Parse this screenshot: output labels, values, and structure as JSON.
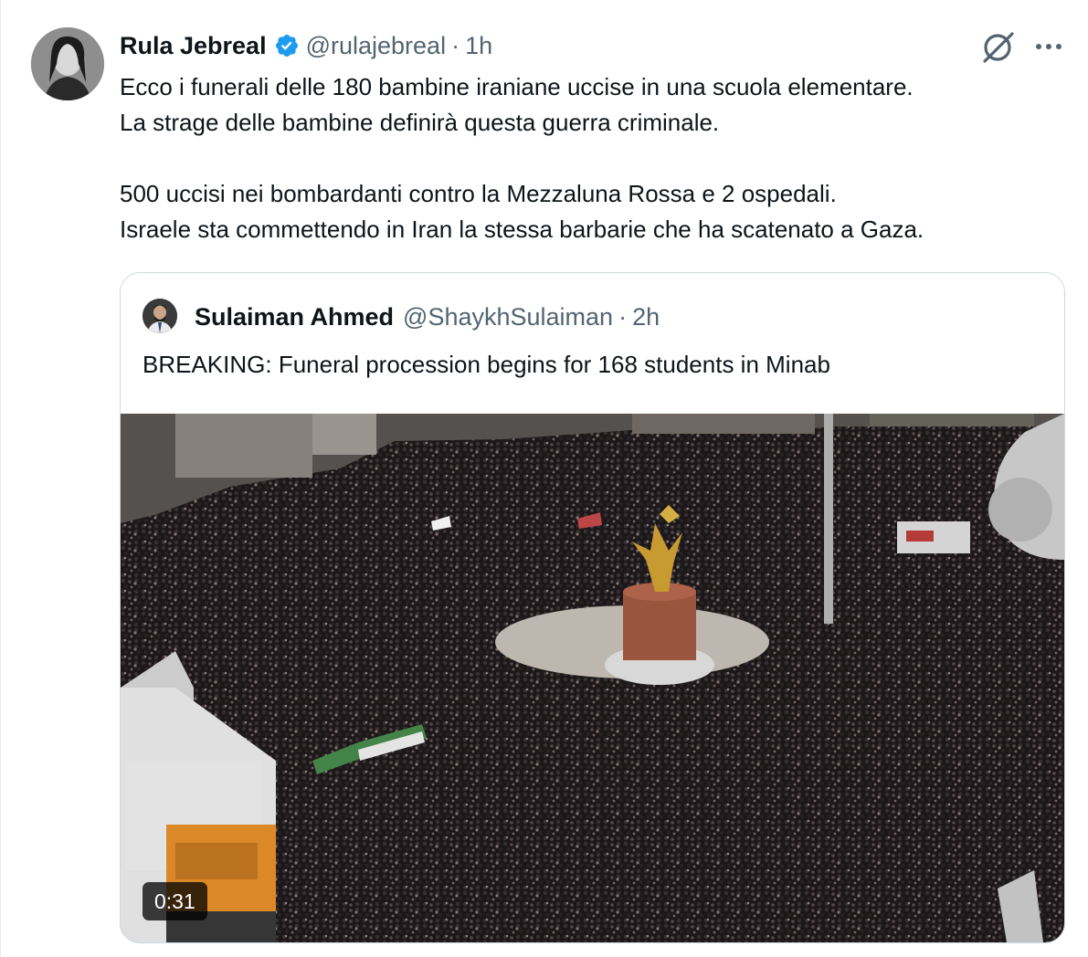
{
  "tweet": {
    "author": {
      "display_name": "Rula Jebreal",
      "handle": "@rulajebreal",
      "verified": true
    },
    "separator": "·",
    "time": "1h",
    "lines": [
      "Ecco i funerali delle 180 bambine iraniane uccise in una scuola elementare.",
      "La strage delle bambine definirà questa guerra criminale.",
      "500 uccisi nei bombardanti contro la Mezzaluna Rossa e 2 ospedali.",
      "Israele sta commettendo in Iran la stessa barbarie che ha scatenato a Gaza."
    ]
  },
  "quoted_tweet": {
    "author": {
      "display_name": "Sulaiman Ahmed",
      "handle": "@ShaykhSulaiman"
    },
    "separator": "·",
    "time": "2h",
    "text": "BREAKING: Funeral procession begins for 168 students in Minab",
    "video": {
      "duration": "0:31"
    }
  },
  "icons": {
    "verified": "verified-badge-icon",
    "grok": "grok-icon",
    "more": "more-options-icon"
  },
  "colors": {
    "verified_blue": "#1d9bf0",
    "secondary_text": "#536471",
    "primary_text": "#0f1419",
    "border": "#cfd9de"
  }
}
